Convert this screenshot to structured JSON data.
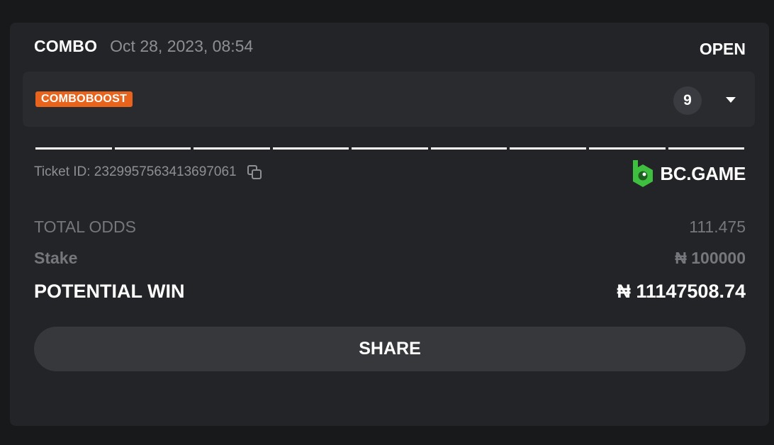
{
  "bet": {
    "type": "COMBO",
    "date": "Oct 28, 2023, 08:54",
    "status": "OPEN",
    "boost_label": "COMBOBOOST",
    "leg_count": "9",
    "segments": 9,
    "ticket_label": "Ticket ID: 2329957563413697061",
    "brand": "BC.GAME"
  },
  "summary": {
    "odds_label": "TOTAL ODDS",
    "odds_value": "111.475",
    "stake_label": "Stake",
    "stake_value": "₦ 100000",
    "win_label": "POTENTIAL WIN",
    "win_value": "₦ 11147508.74"
  },
  "actions": {
    "share_label": "SHARE"
  },
  "colors": {
    "background": "#18191b",
    "card": "#232427",
    "panel": "#2a2b2f",
    "boost": "#e8631c",
    "brand_green": "#3fbf3f",
    "muted_text": "#8e8f94"
  },
  "icons": {
    "expand": "chevron-down-icon",
    "copy": "copy-icon",
    "logo": "bc-game-logo-icon"
  }
}
